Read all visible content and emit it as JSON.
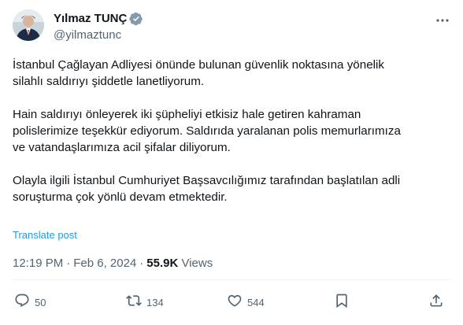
{
  "author": {
    "display_name": "Yılmaz TUNÇ",
    "handle": "@yilmaztunc",
    "verified": true
  },
  "tweet": {
    "paragraphs": [
      [
        "İstanbul Çağlayan Adliyesi önünde bulunan güvenlik noktasına yönelik",
        "silahlı saldırıyı şiddetle lanetliyorum."
      ],
      [
        "Hain saldırıyı önleyerek iki şüpheliyi etkisiz hale getiren kahraman",
        "polislerimize teşekkür ediyorum. Saldırıda yaralanan polis memurlarımıza",
        "ve vatandaşlarımıza acil şifalar diliyorum."
      ],
      [
        "Olayla ilgili İstanbul Cumhuriyet Başsavcılığımız tarafından başlatılan adli",
        "soruşturma çok yönlü devam etmektedir."
      ]
    ],
    "translate_label": "Translate post",
    "time": "12:19 PM",
    "date": "Feb 6, 2024",
    "separator": "·",
    "views_count": "55.9K",
    "views_label": "Views"
  },
  "actions": {
    "reply_icon": "reply-icon",
    "reply_count": "50",
    "retweet_icon": "retweet-icon",
    "retweet_count": "134",
    "like_icon": "heart-icon",
    "like_count": "544",
    "bookmark_icon": "bookmark-icon",
    "share_icon": "share-icon"
  },
  "colors": {
    "text": "#0f1419",
    "muted": "#536471",
    "link": "#1d9bf0",
    "verified_badge": "#829aab",
    "divider": "#eff3f4"
  }
}
